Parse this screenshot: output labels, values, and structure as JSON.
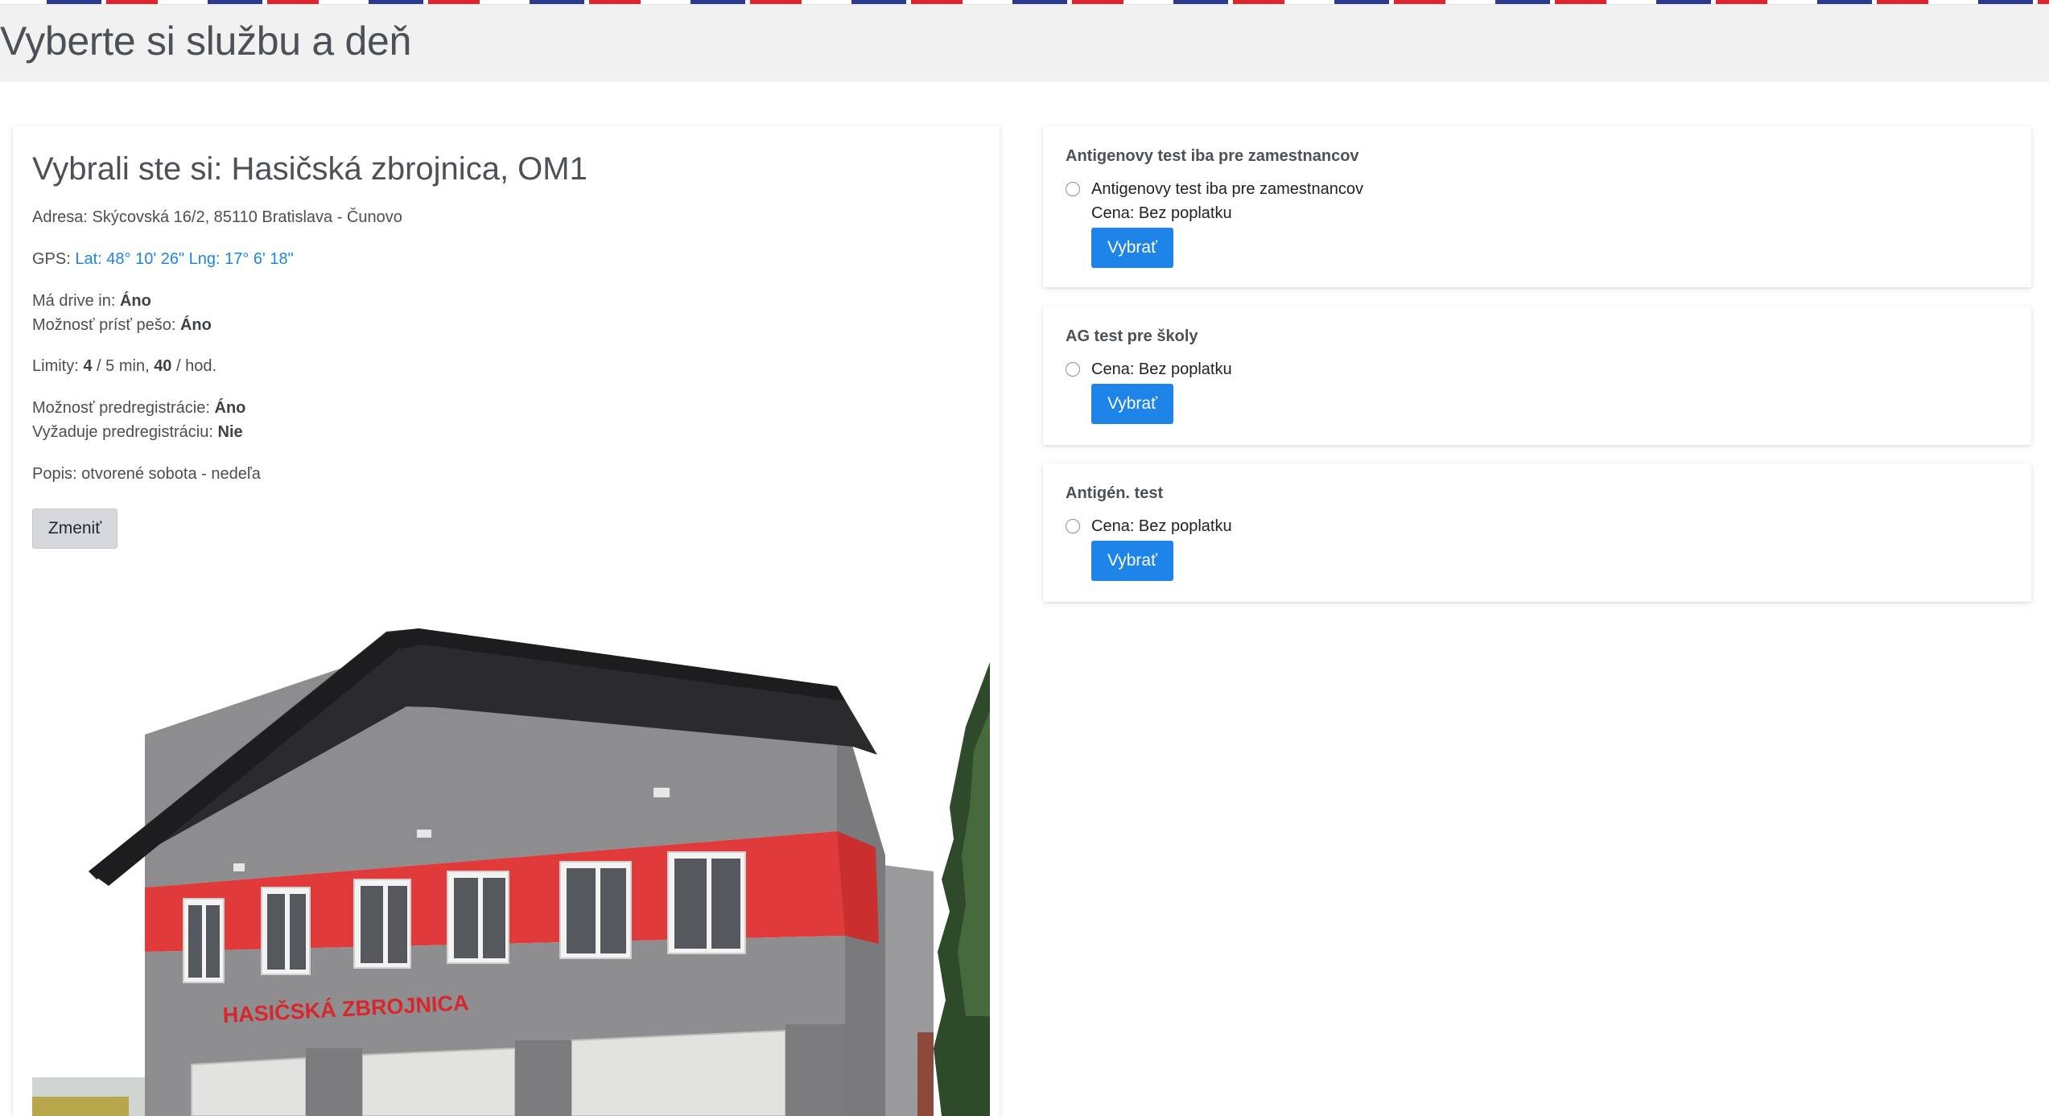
{
  "page_title": "Vyberte si službu a deň",
  "selected_location": {
    "title": "Vybrali ste si: Hasičská zbrojnica, OM1",
    "address_label": "Adresa:",
    "address": "Skýcovská 16/2, 85110 Bratislava - Čunovo",
    "gps_label": "GPS:",
    "gps_value": "Lat: 48° 10' 26\" Lng: 17° 6' 18\"",
    "drive_in_label": "Má drive in:",
    "drive_in_value": "Áno",
    "walk_in_label": "Možnosť prísť pešo:",
    "walk_in_value": "Áno",
    "limits_label": "Limity:",
    "limits_per_5min": "4",
    "limits_per_5min_unit": "/ 5 min,",
    "limits_per_hour": "40",
    "limits_per_hour_unit": "/ hod.",
    "prereg_possible_label": "Možnosť predregistrácie:",
    "prereg_possible_value": "Áno",
    "prereg_required_label": "Vyžaduje predregistráciu:",
    "prereg_required_value": "Nie",
    "description_label": "Popis:",
    "description": "otvorené sobota - nedeľa",
    "change_button": "Zmeniť",
    "photo_sign_text": "HASIČSKÁ ZBROJNICA"
  },
  "services": [
    {
      "title": "Antigenovy test iba pre zamestnancov",
      "option_name": "Antigenovy test iba pre zamestnancov",
      "price": "Cena: Bez poplatku",
      "button": "Vybrať"
    },
    {
      "title": "AG test pre školy",
      "price": "Cena: Bez poplatku",
      "button": "Vybrať"
    },
    {
      "title": "Antigén. test",
      "price": "Cena: Bez poplatku",
      "button": "Vybrať"
    }
  ],
  "colors": {
    "accent": "#1e84e8",
    "header_band": "#f1f1f1",
    "stripe_blue": "#2b3990",
    "stripe_red": "#e0242b",
    "building_red": "#e03a3a",
    "building_gray": "#8d8d90"
  }
}
